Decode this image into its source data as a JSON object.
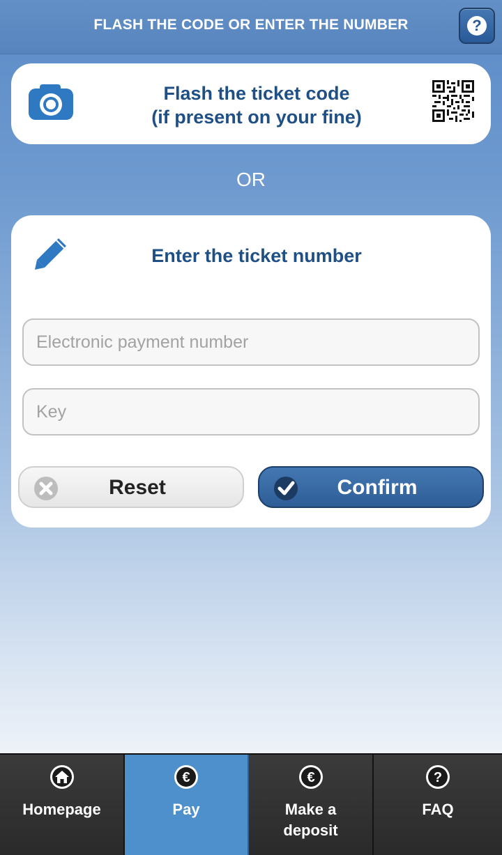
{
  "header": {
    "title": "FLASH THE CODE OR ENTER THE NUMBER",
    "help_icon": "question-icon"
  },
  "flash_card": {
    "title_line1": "Flash the ticket code",
    "title_line2": "(if present on your fine)",
    "left_icon": "camera-icon",
    "right_icon": "qr-code-icon"
  },
  "separator": {
    "text": "OR"
  },
  "enter_card": {
    "icon": "pencil-icon",
    "title": "Enter the ticket number",
    "payment_field": {
      "value": "",
      "placeholder": "Electronic payment number"
    },
    "key_field": {
      "value": "",
      "placeholder": "Key"
    },
    "reset_label": "Reset",
    "confirm_label": "Confirm"
  },
  "tabbar": {
    "tabs": [
      {
        "label_line1": "Homepage",
        "label_line2": "",
        "icon": "home-icon",
        "active": false
      },
      {
        "label_line1": "Pay",
        "label_line2": "",
        "icon": "euro-icon",
        "active": true
      },
      {
        "label_line1": "Make a",
        "label_line2": "deposit",
        "icon": "euro-icon",
        "active": false
      },
      {
        "label_line1": "FAQ",
        "label_line2": "",
        "icon": "question-icon",
        "active": false
      }
    ]
  },
  "colors": {
    "accent": "#1e4f85",
    "header_bg": "#5b89c2",
    "confirm_bg": "#3a6aa6",
    "tab_active": "#4d90cc",
    "tab_bg": "#2a2a2a"
  }
}
